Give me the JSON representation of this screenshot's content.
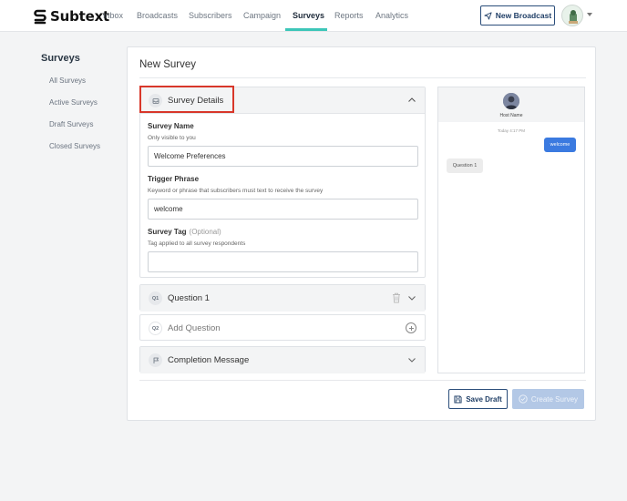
{
  "brand": {
    "name": "Subtext"
  },
  "nav": {
    "items": [
      {
        "label": "Inbox"
      },
      {
        "label": "Broadcasts"
      },
      {
        "label": "Subscribers"
      },
      {
        "label": "Campaign"
      },
      {
        "label": "Surveys",
        "active": true
      },
      {
        "label": "Reports"
      },
      {
        "label": "Analytics"
      }
    ],
    "new_broadcast_label": "New Broadcast",
    "send_icon": "send-icon"
  },
  "sidebar": {
    "title": "Surveys",
    "items": [
      {
        "label": "All Surveys"
      },
      {
        "label": "Active Surveys"
      },
      {
        "label": "Draft Surveys"
      },
      {
        "label": "Closed Surveys"
      }
    ]
  },
  "main": {
    "title": "New Survey",
    "details": {
      "label": "Survey Details",
      "expanded": true,
      "fields": {
        "name": {
          "label": "Survey Name",
          "help": "Only visible to you",
          "value": "Welcome Preferences"
        },
        "trigger": {
          "label": "Trigger Phrase",
          "help": "Keyword or phrase that subscribers must text to receive the survey",
          "value": "welcome"
        },
        "tag": {
          "label": "Survey Tag",
          "optional": "(Optional)",
          "help": "Tag applied to all survey respondents",
          "value": ""
        }
      }
    },
    "question1": {
      "badge": "Q1",
      "label": "Question 1"
    },
    "add_question": {
      "badge": "Q2",
      "label": "Add Question"
    },
    "completion": {
      "label": "Completion Message"
    }
  },
  "preview": {
    "host_name": "Host Name",
    "timestamp": "Today 4:17 PM",
    "outgoing": "welcome",
    "incoming": "Question 1"
  },
  "actions": {
    "save_draft": "Save Draft",
    "create_survey": "Create Survey"
  },
  "colors": {
    "accent": "#3cc6b8",
    "primary": "#1f3e66",
    "highlight": "#d8372a",
    "bubble": "#3b7ae0",
    "disabled": "#b3c8e6"
  }
}
